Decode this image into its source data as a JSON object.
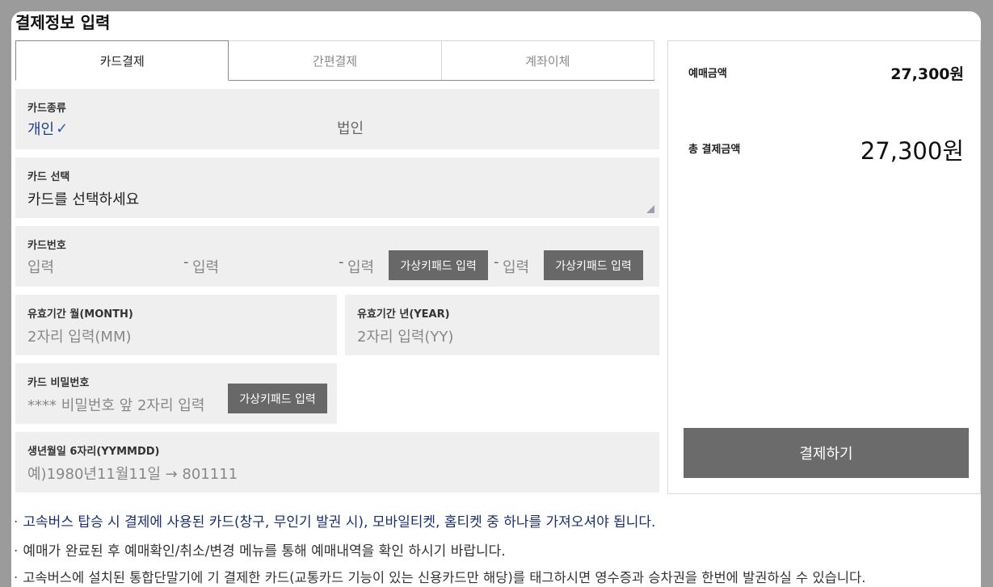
{
  "page_title": "결제정보 입력",
  "tabs": [
    {
      "label": "카드결제",
      "active": true
    },
    {
      "label": "간편결제",
      "active": false
    },
    {
      "label": "계좌이체",
      "active": false
    }
  ],
  "card_type": {
    "label": "카드종류",
    "options": [
      "개인",
      "법인"
    ],
    "selected": "개인",
    "check": "✓"
  },
  "card_select": {
    "label": "카드 선택",
    "value": "카드를 선택하세요"
  },
  "card_number": {
    "label": "카드번호",
    "placeholder": "입력",
    "dash": "-",
    "virtual_keypad_label": "가상키패드 입력"
  },
  "expiry_month": {
    "label": "유효기간 월(MONTH)",
    "placeholder": "2자리 입력(MM)"
  },
  "expiry_year": {
    "label": "유효기간 년(YEAR)",
    "placeholder": "2자리 입력(YY)"
  },
  "card_password": {
    "label": "카드 비밀번호",
    "placeholder": "**** 비밀번호 앞 2자리 입력",
    "virtual_keypad_label": "가상키패드 입력"
  },
  "birth_date": {
    "label": "생년월일 6자리(YYMMDD)",
    "placeholder": "예)1980년11월11일 → 801111"
  },
  "summary": {
    "ticket_amount_label": "예매금액",
    "ticket_amount": "27,300원",
    "total_label": "총 결제금액",
    "total_amount": "27,300원",
    "pay_button": "결제하기"
  },
  "notices": [
    "고속버스 탑승 시 결제에 사용된 카드(창구, 무인기 발권 시), 모바일티켓, 홈티켓 중 하나를 가져오셔야 됩니다.",
    "예매가 완료된 후 예매확인/취소/변경 메뉴를 통해 예매내역을 확인 하시기 바랍니다.",
    "고속버스에 설치된 통합단말기에 기 결제한 카드(교통카드 기능이 있는 신용카드만 해당)를 태그하시면 영수증과 승차권을 한번에 발권하실 수 있습니다."
  ],
  "notice_bullet": "·",
  "colors": {
    "accent_blue": "#2f59c9",
    "button_gray": "#686868",
    "field_bg": "#efefef"
  }
}
